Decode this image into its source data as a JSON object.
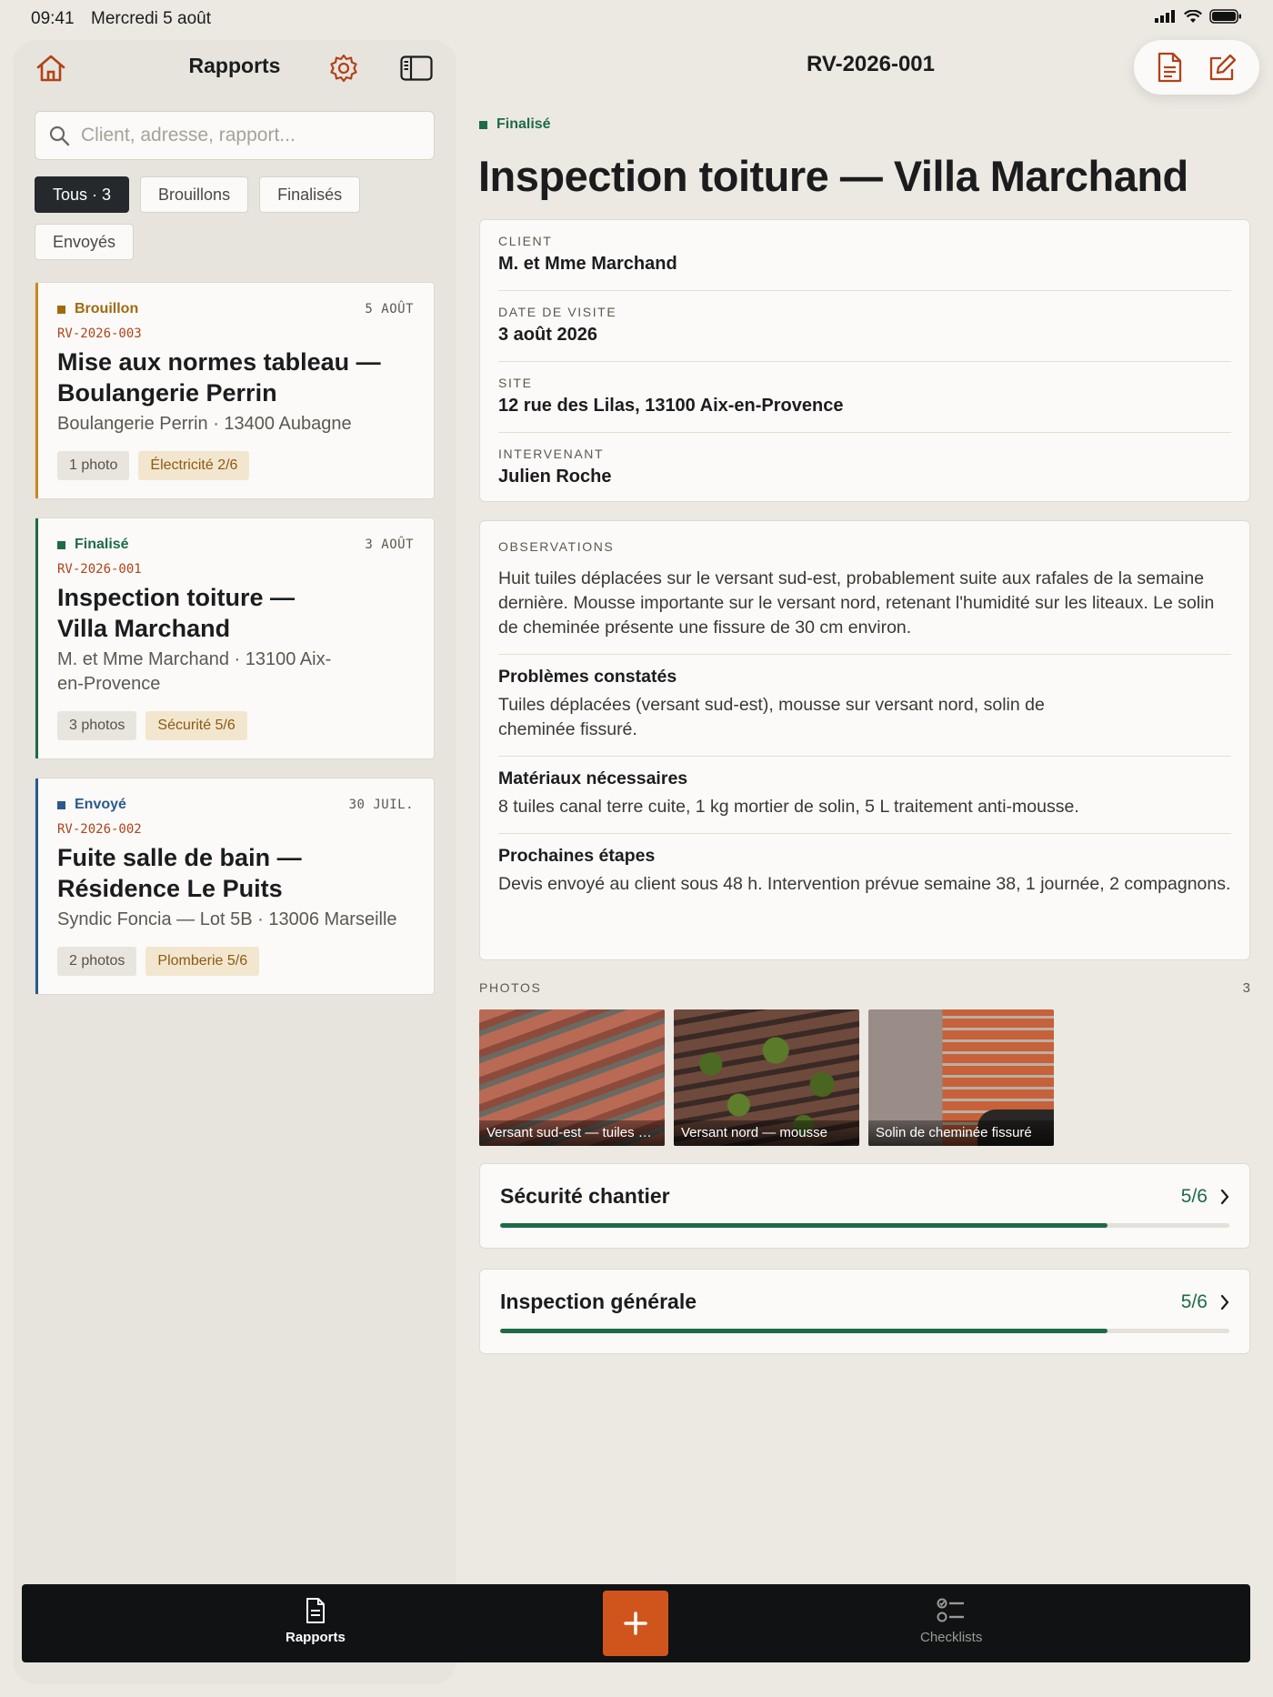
{
  "status_bar": {
    "time": "09:41",
    "date": "Mercredi 5 août"
  },
  "sidebar": {
    "title": "Rapports",
    "search_placeholder": "Client, adresse, rapport...",
    "filters": [
      {
        "label": "Tous · 3",
        "active": true
      },
      {
        "label": "Brouillons",
        "active": false
      },
      {
        "label": "Finalisés",
        "active": false
      },
      {
        "label": "Envoyés",
        "active": false
      }
    ],
    "reports": [
      {
        "status": "Brouillon",
        "status_color": "#a06a10",
        "accent": "#c48a1e",
        "date": "5 AOÛT",
        "ref": "RV-2026-003",
        "title": "Mise aux normes tableau — Boulangerie Perrin",
        "subtitle": "Boulangerie Perrin · 13400 Aubagne",
        "photos": "1 photo",
        "checklist": "Électricité 2/6"
      },
      {
        "status": "Finalisé",
        "status_color": "#1e6b46",
        "accent": "#1e6b46",
        "date": "3 AOÛT",
        "ref": "RV-2026-001",
        "title": "Inspection toiture — Villa Marchand",
        "subtitle": "M. et Mme Marchand · 13100 Aix-en-Provence",
        "photos": "3 photos",
        "checklist": "Sécurité 5/6"
      },
      {
        "status": "Envoyé",
        "status_color": "#2c5a8a",
        "accent": "#2c5a8a",
        "date": "30 JUIL.",
        "ref": "RV-2026-002",
        "title": "Fuite salle de bain — Résidence Le Puits",
        "subtitle": "Syndic Foncia — Lot 5B · 13006 Marseille",
        "photos": "2 photos",
        "checklist": "Plomberie 5/6"
      }
    ]
  },
  "detail": {
    "ref": "RV-2026-001",
    "status": "Finalisé",
    "title": "Inspection toiture — Villa Marchand",
    "info": {
      "client_label": "CLIENT",
      "client": "M. et Mme Marchand",
      "date_label": "DATE DE VISITE",
      "date": "3 août 2026",
      "site_label": "SITE",
      "site": "12 rue des Lilas, 13100 Aix-en-Provence",
      "tech_label": "INTERVENANT",
      "tech": "Julien Roche"
    },
    "observations": {
      "label": "OBSERVATIONS",
      "text": "Huit tuiles déplacées sur le versant sud-est, probablement suite aux rafales de la semaine dernière. Mousse importante sur le versant nord, retenant l'humidité sur les liteaux. Le solin de cheminée présente une fissure de 30 cm environ.",
      "problems_title": "Problèmes constatés",
      "problems": "Tuiles déplacées (versant sud-est), mousse sur versant nord, solin de cheminée fissuré.",
      "materials_title": "Matériaux nécessaires",
      "materials": "8 tuiles canal terre cuite, 1 kg mortier de solin, 5 L traitement anti-mousse.",
      "next_title": "Prochaines étapes",
      "next": "Devis envoyé au client sous 48 h. Intervention prévue semaine 38, 1 journée, 2 compagnons."
    },
    "photos_label": "PHOTOS",
    "photos_count": "3",
    "photos": [
      {
        "caption": "Versant sud-est — tuiles déplacées"
      },
      {
        "caption": "Versant nord — mousse"
      },
      {
        "caption": "Solin de cheminée fissuré"
      }
    ],
    "checklists": [
      {
        "name": "Sécurité chantier",
        "score": "5/6",
        "progress": 0.833
      },
      {
        "name": "Inspection générale",
        "score": "5/6",
        "progress": 0.833
      }
    ]
  },
  "tabbar": {
    "reports_label": "Rapports",
    "checklists_label": "Checklists",
    "fab_label": "+"
  },
  "colors": {
    "accent": "#d0551c",
    "success": "#1e6b46",
    "icon": "#b0421a"
  }
}
